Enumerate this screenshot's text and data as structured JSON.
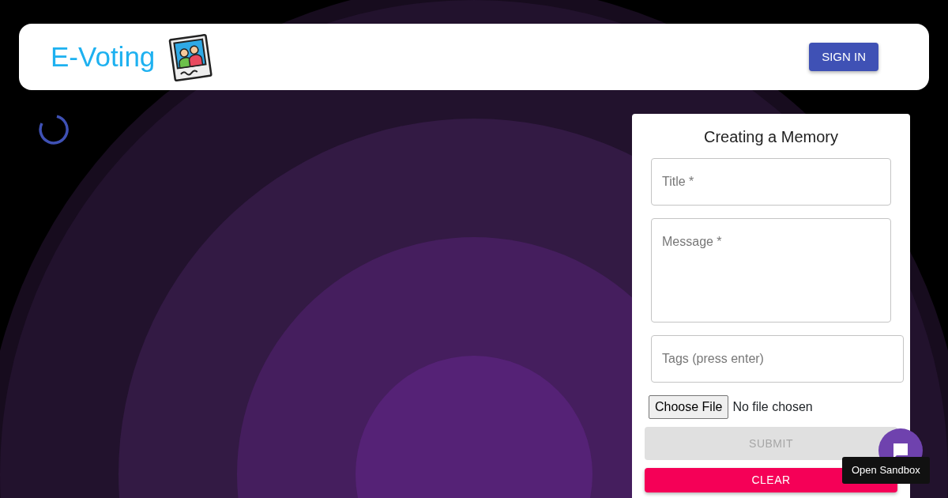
{
  "header": {
    "brand": "E-Voting",
    "button": "SIGN IN"
  },
  "form": {
    "title": "Creating a Memory",
    "fields": [
      {
        "kind": "input",
        "placeholder": "Title *"
      },
      {
        "kind": "textarea",
        "placeholder": "Message *"
      },
      {
        "kind": "wide",
        "placeholder": "Tags (press enter)"
      }
    ],
    "file": {
      "button": "Choose File",
      "status": "No file chosen"
    },
    "buttons": [
      {
        "kind": "submit",
        "label": "SUBMIT",
        "disabled": true
      },
      {
        "kind": "clear",
        "label": "CLEAR",
        "disabled": false
      }
    ]
  },
  "tooltip": "Open Sandbox"
}
